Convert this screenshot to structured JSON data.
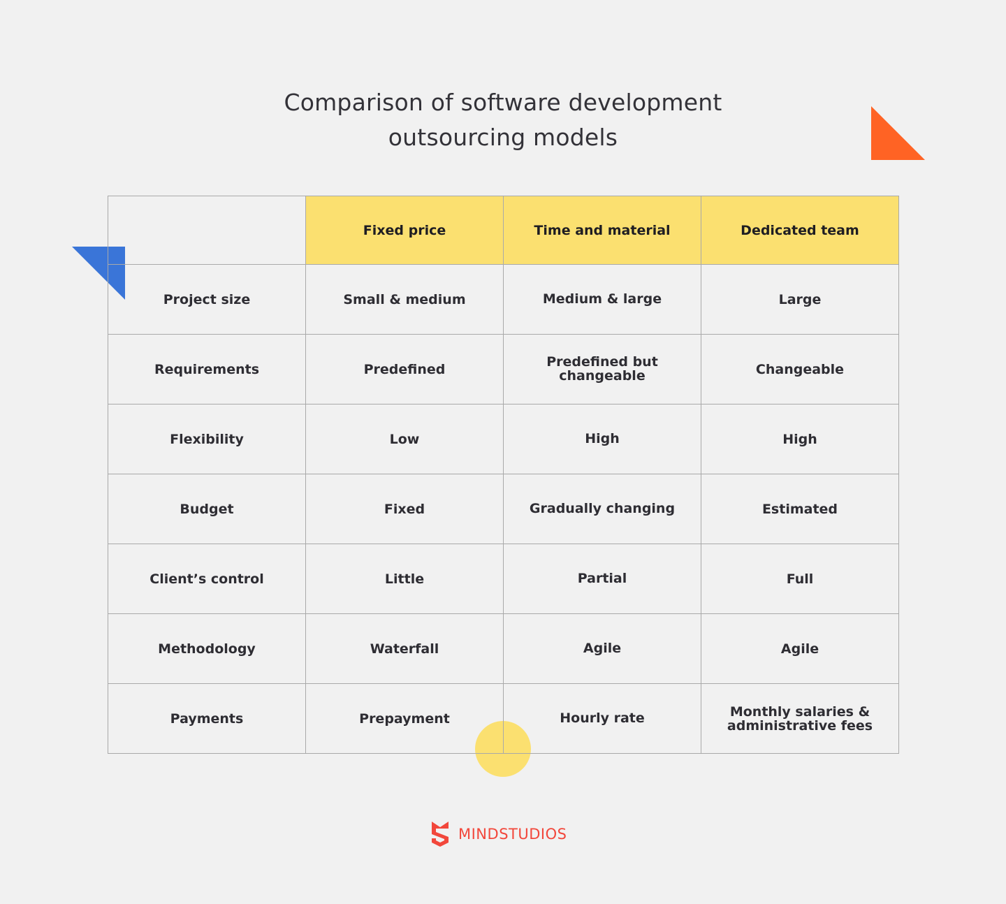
{
  "title": {
    "line1": "Comparison of software development",
    "line2": "outsourcing models"
  },
  "table": {
    "columns": [
      "",
      "Fixed price",
      "Time and material",
      "Dedicated team"
    ],
    "rows": [
      {
        "label": "Project size",
        "fixed_price": "Small & medium",
        "time_and_material": "Medium & large",
        "dedicated_team": "Large"
      },
      {
        "label": "Requirements",
        "fixed_price": "Predefined",
        "time_and_material": "Predefined but changeable",
        "dedicated_team": "Changeable"
      },
      {
        "label": "Flexibility",
        "fixed_price": "Low",
        "time_and_material": "High",
        "dedicated_team": "High"
      },
      {
        "label": "Budget",
        "fixed_price": "Fixed",
        "time_and_material": "Gradually changing",
        "dedicated_team": "Estimated"
      },
      {
        "label": "Client’s control",
        "fixed_price": "Little",
        "time_and_material": "Partial",
        "dedicated_team": "Full"
      },
      {
        "label": "Methodology",
        "fixed_price": "Waterfall",
        "time_and_material": "Agile",
        "dedicated_team": "Agile"
      },
      {
        "label": "Payments",
        "fixed_price": "Prepayment",
        "time_and_material": "Hourly rate",
        "dedicated_team": "Monthly salaries & administrative fees"
      }
    ]
  },
  "colors": {
    "header_fill": "#fbe070",
    "accent_orange": "#ff6324",
    "accent_blue": "#3a75d8",
    "accent_yellow": "#fbe070",
    "brand_red": "#f2473b",
    "background": "#f1f1f1"
  },
  "logo": {
    "icon": "mindstudios-shield-icon",
    "text": "MINDSTUDIOS"
  }
}
